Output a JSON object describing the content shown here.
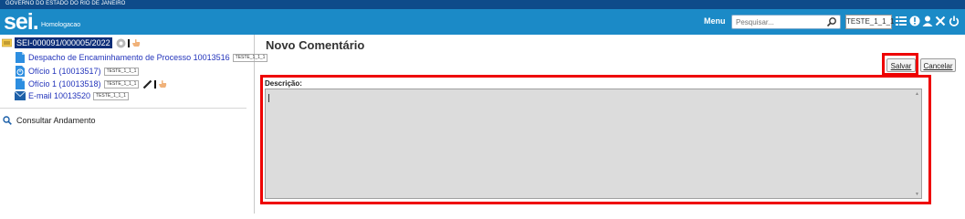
{
  "gov_banner": "GOVERNO DO ESTADO DO RIO DE JANEIRO",
  "header": {
    "logo": "sei.",
    "environment": "Homologacao",
    "menu_label": "Menu",
    "search_placeholder": "Pesquisar...",
    "unit": "TESTE_1_1_1",
    "icons": [
      "grid-icon",
      "info-icon",
      "user-icon",
      "tools-icon",
      "power-icon"
    ],
    "bg_color": "#1b8ac7",
    "top_bar_color": "#0e4b8a"
  },
  "sidebar": {
    "process_number": "SEI-000091/000005/2022",
    "documents": [
      {
        "label": "Despacho de Encaminhamento de Processo 10013516",
        "tag": "TESTE_1_1_1",
        "icon": "document-icon"
      },
      {
        "label": "Ofício 1 (10013517)",
        "tag": "TESTE_1_1_1",
        "icon": "document-clock-icon"
      },
      {
        "label": "Ofício 1 (10013518)",
        "tag": "TESTE_1_1_1",
        "icon": "document-icon"
      },
      {
        "label": "E-mail 10013520",
        "tag": "TESTE_1_1_1",
        "icon": "envelope-icon"
      }
    ],
    "consult_label": "Consultar Andamento"
  },
  "main": {
    "title": "Novo Comentário",
    "save_label": "Salvar",
    "cancel_label": "Cancelar",
    "description_label": "Descrição:",
    "description_value": "",
    "highlight_color": "#ee0000"
  }
}
